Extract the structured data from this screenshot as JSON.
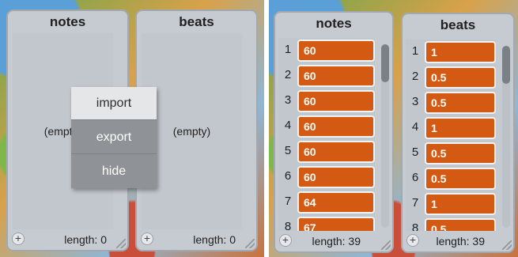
{
  "left": {
    "notes": {
      "title": "notes",
      "empty_text": "(empty)",
      "length_text": "length: 0"
    },
    "beats": {
      "title": "beats",
      "empty_text": "(empty)",
      "length_text": "length: 0"
    },
    "context_menu": {
      "items": [
        {
          "label": "import"
        },
        {
          "label": "export"
        },
        {
          "label": "hide"
        }
      ]
    }
  },
  "right": {
    "notes": {
      "title": "notes",
      "length_text": "length: 39",
      "rows": [
        {
          "index": "1",
          "value": "60"
        },
        {
          "index": "2",
          "value": "60"
        },
        {
          "index": "3",
          "value": "60"
        },
        {
          "index": "4",
          "value": "60"
        },
        {
          "index": "5",
          "value": "60"
        },
        {
          "index": "6",
          "value": "60"
        },
        {
          "index": "7",
          "value": "64"
        },
        {
          "index": "8",
          "value": "67"
        }
      ]
    },
    "beats": {
      "title": "beats",
      "length_text": "length: 39",
      "rows": [
        {
          "index": "1",
          "value": "1"
        },
        {
          "index": "2",
          "value": "0.5"
        },
        {
          "index": "3",
          "value": "0.5"
        },
        {
          "index": "4",
          "value": "1"
        },
        {
          "index": "5",
          "value": "0.5"
        },
        {
          "index": "6",
          "value": "0.5"
        },
        {
          "index": "7",
          "value": "1"
        },
        {
          "index": "8",
          "value": "0.5"
        }
      ]
    }
  },
  "icons": {
    "add": "plus-icon",
    "resize": "resize-grip-icon"
  },
  "colors": {
    "cell": "#d45a14",
    "monitor": "#c6cbd1",
    "menu": "#8f9296",
    "menu_highlight": "#e4e6e8"
  }
}
